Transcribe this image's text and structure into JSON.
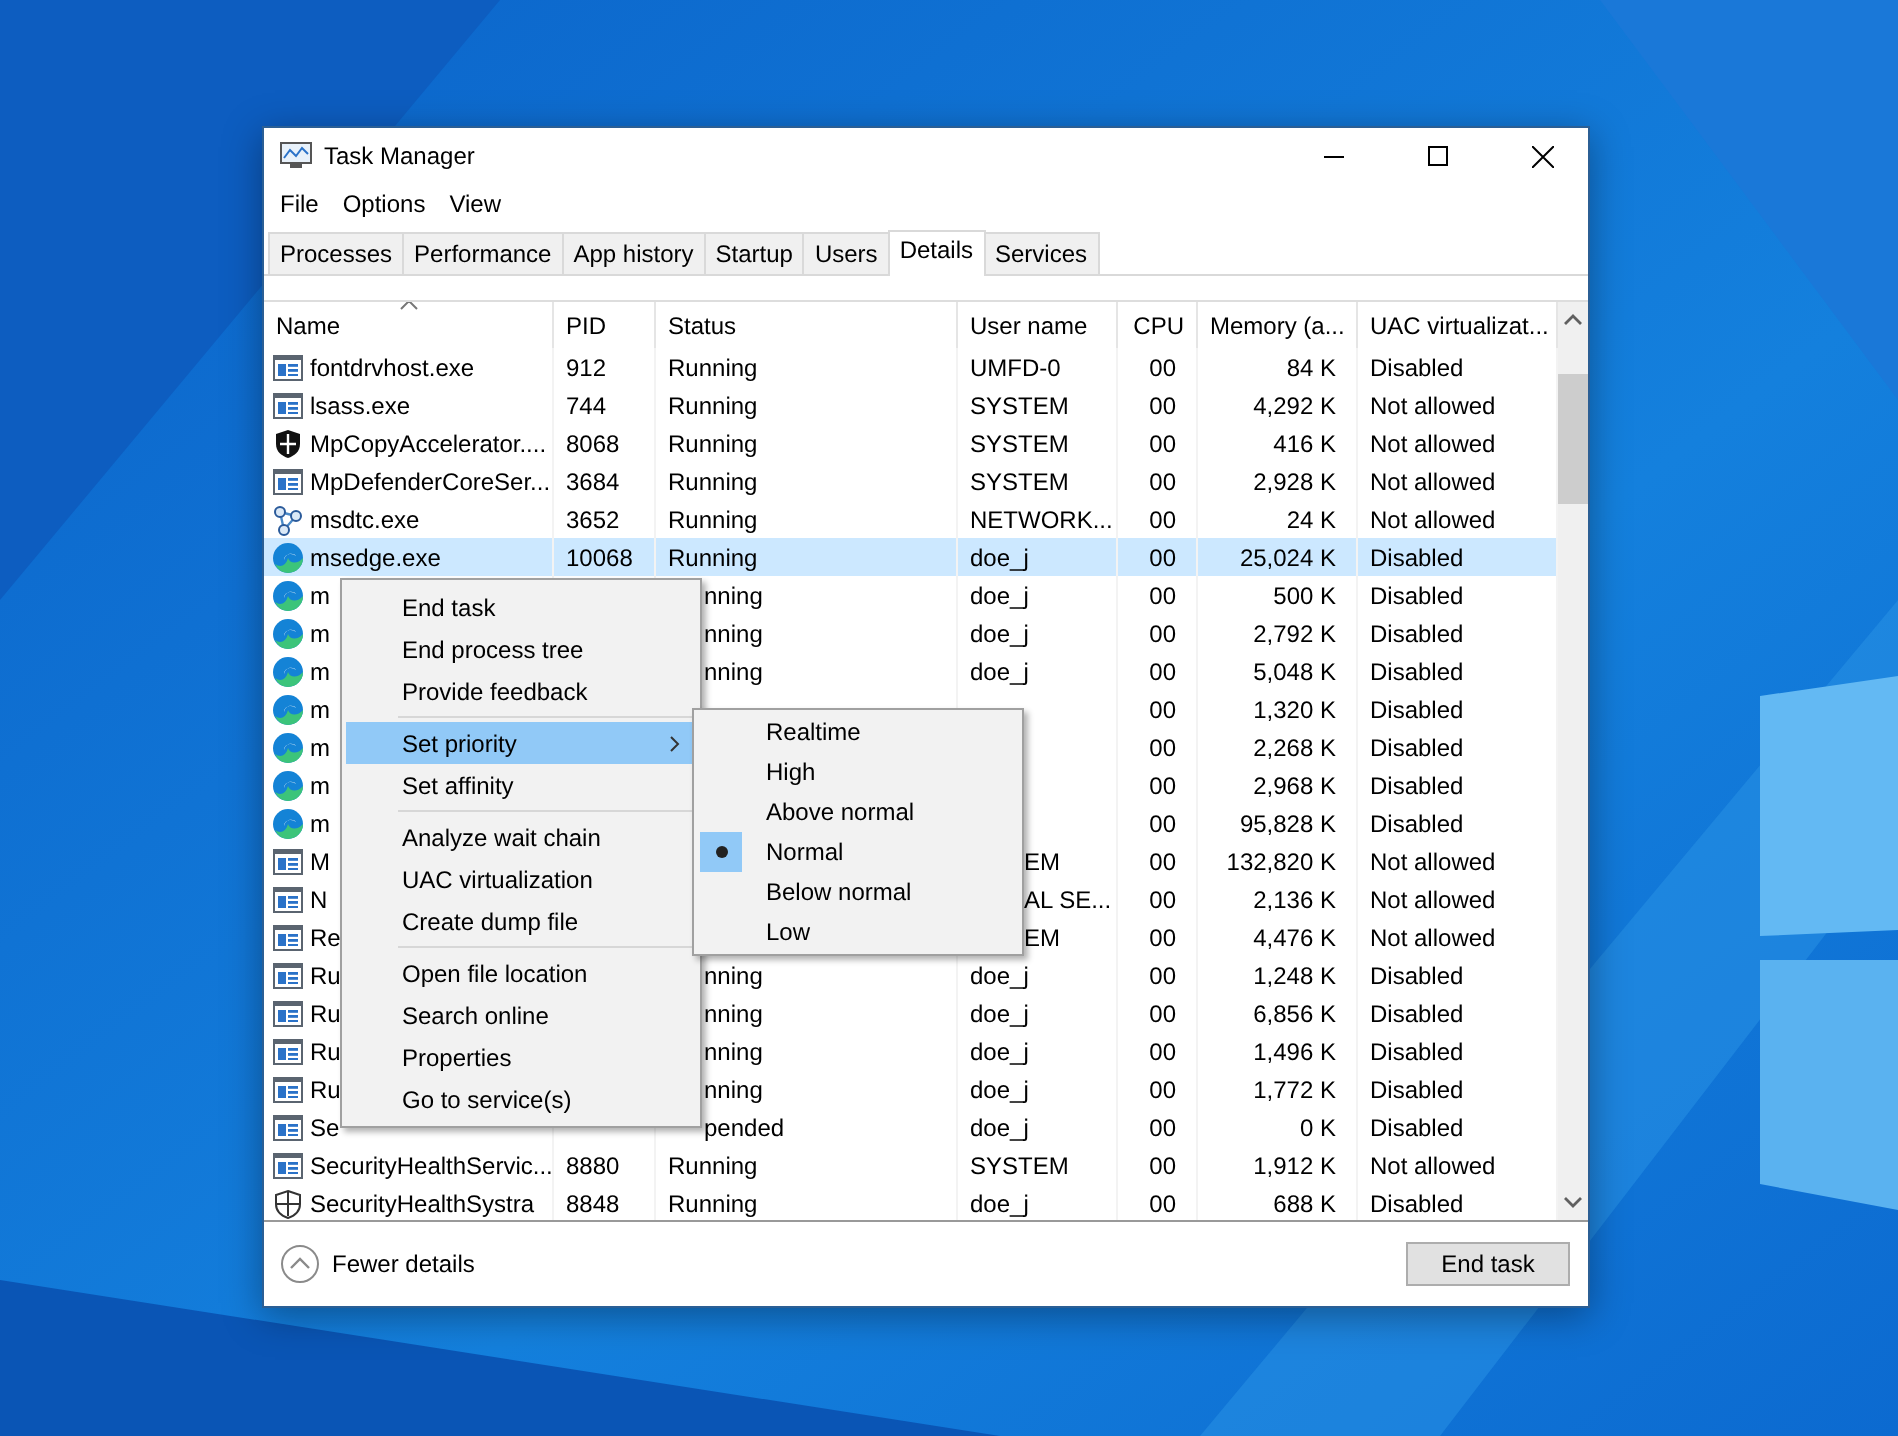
{
  "window": {
    "title": "Task Manager"
  },
  "menu_bar": [
    "File",
    "Options",
    "View"
  ],
  "tabs": [
    {
      "label": "Processes",
      "selected": false
    },
    {
      "label": "Performance",
      "selected": false
    },
    {
      "label": "App history",
      "selected": false
    },
    {
      "label": "Startup",
      "selected": false
    },
    {
      "label": "Users",
      "selected": false
    },
    {
      "label": "Details",
      "selected": true
    },
    {
      "label": "Services",
      "selected": false
    }
  ],
  "table": {
    "columns": [
      {
        "label": "Name",
        "sorted": true
      },
      {
        "label": "PID",
        "sorted": false
      },
      {
        "label": "Status",
        "sorted": false
      },
      {
        "label": "User name",
        "sorted": false
      },
      {
        "label": "CPU",
        "sorted": false
      },
      {
        "label": "Memory (a...",
        "sorted": false
      },
      {
        "label": "UAC virtualizat...",
        "sorted": false
      }
    ],
    "rows": [
      {
        "kind": "app",
        "selected": false,
        "cells": [
          "fontdrvhost.exe",
          "912",
          "Running",
          "UMFD-0",
          "00",
          "84 K",
          "Disabled"
        ]
      },
      {
        "kind": "app",
        "selected": false,
        "cells": [
          "lsass.exe",
          "744",
          "Running",
          "SYSTEM",
          "00",
          "4,292 K",
          "Not allowed"
        ]
      },
      {
        "kind": "shield",
        "selected": false,
        "cells": [
          "MpCopyAccelerator....",
          "8068",
          "Running",
          "SYSTEM",
          "00",
          "416 K",
          "Not allowed"
        ]
      },
      {
        "kind": "app",
        "selected": false,
        "cells": [
          "MpDefenderCoreSer...",
          "3684",
          "Running",
          "SYSTEM",
          "00",
          "2,928 K",
          "Not allowed"
        ]
      },
      {
        "kind": "network",
        "selected": false,
        "cells": [
          "msdtc.exe",
          "3652",
          "Running",
          "NETWORK...",
          "00",
          "24 K",
          "Not allowed"
        ]
      },
      {
        "kind": "swirl",
        "selected": true,
        "cells": [
          "msedge.exe",
          "10068",
          "Running",
          "doe_j",
          "00",
          "25,024 K",
          "Disabled"
        ]
      },
      {
        "kind": "swirl",
        "selected": false,
        "cells": [
          "m",
          null,
          "nning",
          "doe_j",
          "00",
          "500 K",
          "Disabled"
        ]
      },
      {
        "kind": "swirl",
        "selected": false,
        "cells": [
          "m",
          null,
          "nning",
          "doe_j",
          "00",
          "2,792 K",
          "Disabled"
        ]
      },
      {
        "kind": "swirl",
        "selected": false,
        "cells": [
          "m",
          null,
          "nning",
          "doe_j",
          "00",
          "5,048 K",
          "Disabled"
        ]
      },
      {
        "kind": "swirl",
        "selected": false,
        "cells": [
          "m",
          null,
          null,
          null,
          "00",
          "1,320 K",
          "Disabled"
        ]
      },
      {
        "kind": "swirl",
        "selected": false,
        "cells": [
          "m",
          null,
          null,
          null,
          "00",
          "2,268 K",
          "Disabled"
        ]
      },
      {
        "kind": "swirl",
        "selected": false,
        "cells": [
          "m",
          null,
          null,
          null,
          "00",
          "2,968 K",
          "Disabled"
        ]
      },
      {
        "kind": "swirl",
        "selected": false,
        "cells": [
          "m",
          null,
          null,
          null,
          "00",
          "95,828 K",
          "Disabled"
        ]
      },
      {
        "kind": "app",
        "selected": false,
        "cells": [
          "M",
          null,
          null,
          "EM",
          "00",
          "132,820 K",
          "Not allowed"
        ]
      },
      {
        "kind": "app",
        "selected": false,
        "cells": [
          "N",
          null,
          null,
          "AL SE...",
          "00",
          "2,136 K",
          "Not allowed"
        ]
      },
      {
        "kind": "app",
        "selected": false,
        "cells": [
          "Re",
          null,
          null,
          "EM",
          "00",
          "4,476 K",
          "Not allowed"
        ]
      },
      {
        "kind": "app",
        "selected": false,
        "cells": [
          "Ru",
          null,
          "nning",
          "doe_j",
          "00",
          "1,248 K",
          "Disabled"
        ]
      },
      {
        "kind": "app",
        "selected": false,
        "cells": [
          "Ru",
          null,
          "nning",
          "doe_j",
          "00",
          "6,856 K",
          "Disabled"
        ]
      },
      {
        "kind": "app",
        "selected": false,
        "cells": [
          "Ru",
          null,
          "nning",
          "doe_j",
          "00",
          "1,496 K",
          "Disabled"
        ]
      },
      {
        "kind": "app",
        "selected": false,
        "cells": [
          "Ru",
          null,
          "nning",
          "doe_j",
          "00",
          "1,772 K",
          "Disabled"
        ]
      },
      {
        "kind": "app",
        "selected": false,
        "cells": [
          "Se",
          null,
          "pended",
          "doe_j",
          "00",
          "0 K",
          "Disabled"
        ]
      },
      {
        "kind": "app",
        "selected": false,
        "cells": [
          "SecurityHealthServic...",
          "8880",
          "Running",
          "SYSTEM",
          "00",
          "1,912 K",
          "Not allowed"
        ]
      },
      {
        "kind": "shield-outline",
        "selected": false,
        "cells": [
          "SecurityHealthSystra",
          "8848",
          "Running",
          "doe_j",
          "00",
          "688 K",
          "Disabled"
        ]
      }
    ]
  },
  "context_menu": {
    "groups": [
      [
        {
          "label": "End task",
          "selected": false,
          "submenu": false
        },
        {
          "label": "End process tree",
          "selected": false,
          "submenu": false
        },
        {
          "label": "Provide feedback",
          "selected": false,
          "submenu": false
        }
      ],
      [
        {
          "label": "Set priority",
          "selected": true,
          "submenu": true
        },
        {
          "label": "Set affinity",
          "selected": false,
          "submenu": false
        }
      ],
      [
        {
          "label": "Analyze wait chain",
          "selected": false,
          "submenu": false
        },
        {
          "label": "UAC virtualization",
          "selected": false,
          "submenu": false
        },
        {
          "label": "Create dump file",
          "selected": false,
          "submenu": false
        }
      ],
      [
        {
          "label": "Open file location",
          "selected": false,
          "submenu": false
        },
        {
          "label": "Search online",
          "selected": false,
          "submenu": false
        },
        {
          "label": "Properties",
          "selected": false,
          "submenu": false
        },
        {
          "label": "Go to service(s)",
          "selected": false,
          "submenu": false
        }
      ]
    ]
  },
  "priority_submenu": [
    {
      "label": "Realtime",
      "checked": false
    },
    {
      "label": "High",
      "checked": false
    },
    {
      "label": "Above normal",
      "checked": false
    },
    {
      "label": "Normal",
      "checked": true
    },
    {
      "label": "Below normal",
      "checked": false
    },
    {
      "label": "Low",
      "checked": false
    }
  ],
  "footer": {
    "toggle": "Fewer details",
    "button": "End task"
  }
}
